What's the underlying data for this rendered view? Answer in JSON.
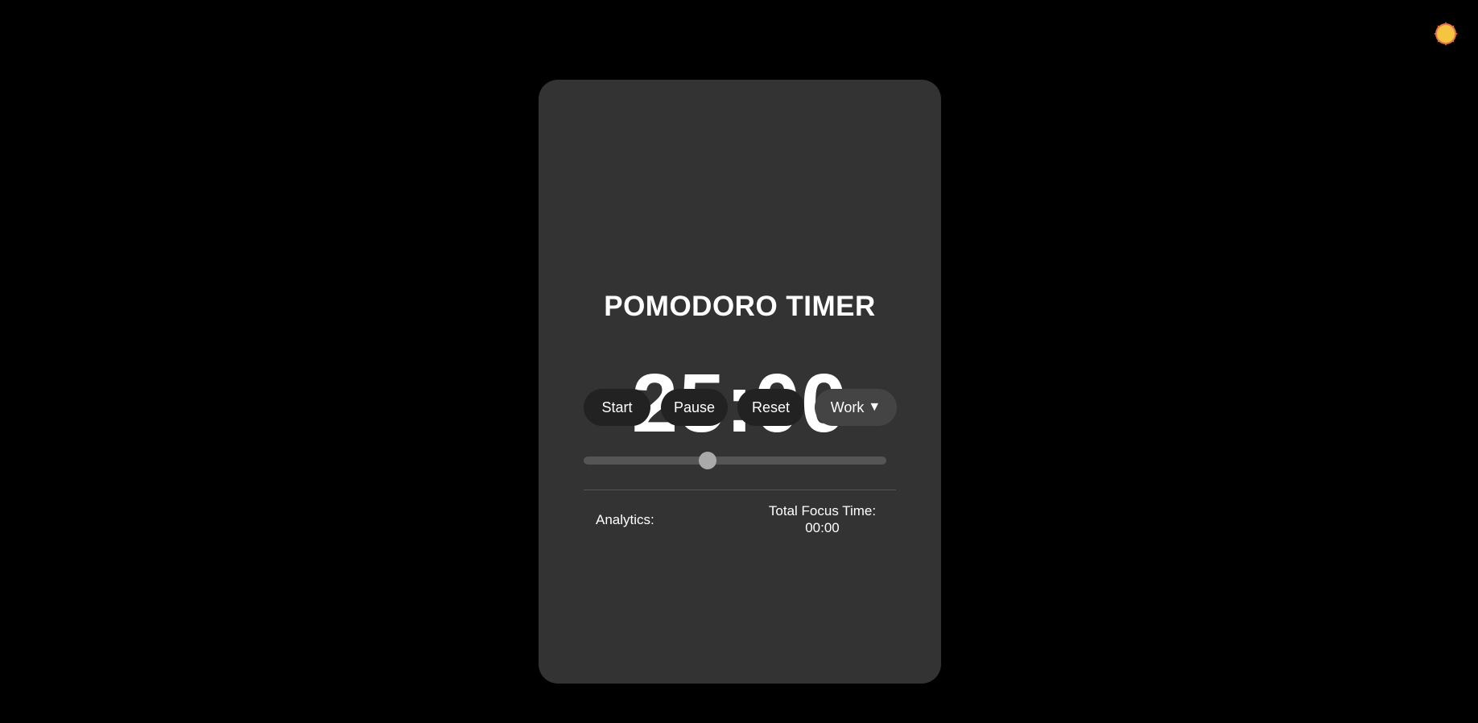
{
  "theme_toggle": {
    "icon": "sun-icon",
    "color": "#f5c542",
    "outline_color": "#e8734a"
  },
  "card": {
    "title": "POMODORO TIMER",
    "time": "25:00",
    "buttons": {
      "start": "Start",
      "pause": "Pause",
      "reset": "Reset",
      "mode": "Work",
      "mode_caret": "▼"
    },
    "slider": {
      "value_fraction": 0.41
    },
    "analytics": {
      "label": "Analytics:",
      "total_focus_label": "Total Focus Time:",
      "total_focus_value": "00:00"
    }
  },
  "colors": {
    "background": "#000000",
    "card": "#333333",
    "button": "#222222",
    "mode_button": "#444444",
    "text": "#ffffff"
  }
}
